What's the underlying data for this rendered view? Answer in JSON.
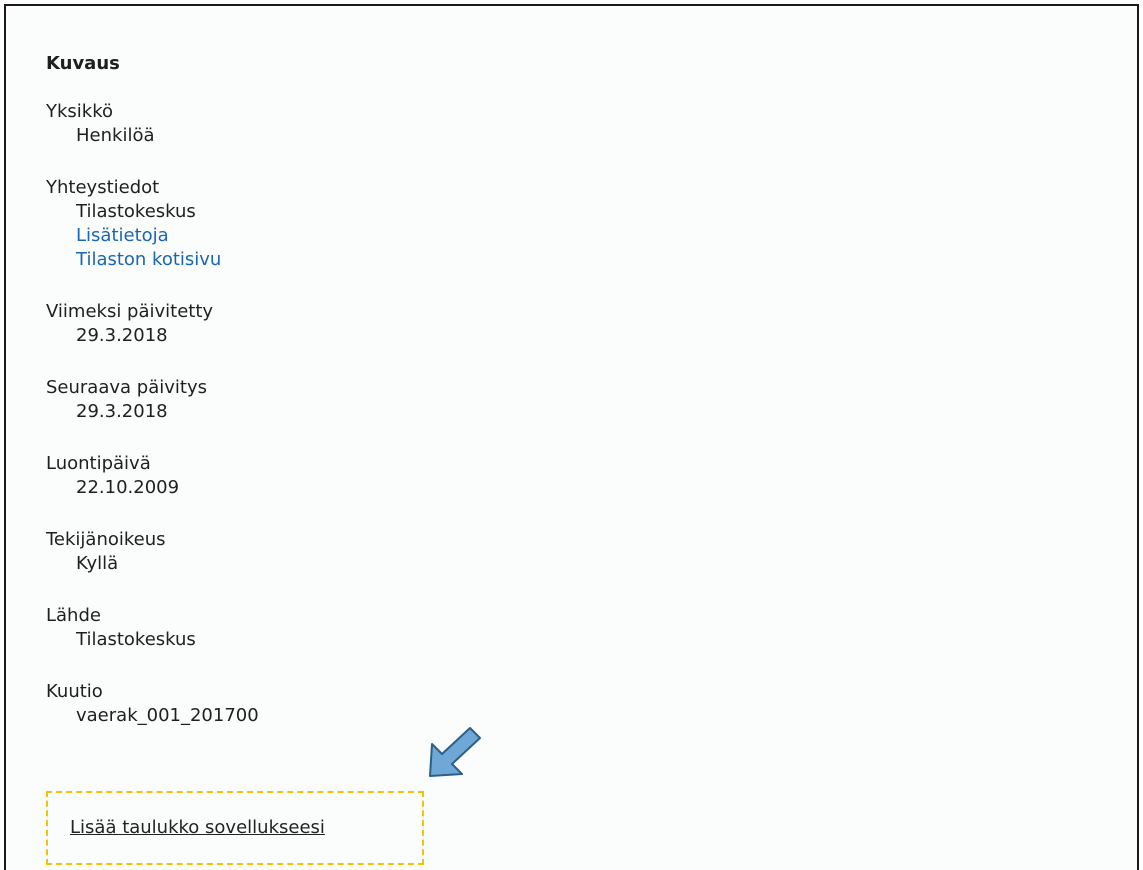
{
  "heading": "Kuvaus",
  "fields": {
    "unit": {
      "label": "Yksikkö",
      "value": "Henkilöä"
    },
    "contact": {
      "label": "Yhteystiedot",
      "value": "Tilastokeskus",
      "link_more": "Lisätietoja",
      "link_home": "Tilaston kotisivu"
    },
    "last_updated": {
      "label": "Viimeksi päivitetty",
      "value": "29.3.2018"
    },
    "next_update": {
      "label": "Seuraava päivitys",
      "value": "29.3.2018"
    },
    "created": {
      "label": "Luontipäivä",
      "value": "22.10.2009"
    },
    "copyright": {
      "label": "Tekijänoikeus",
      "value": "Kyllä"
    },
    "source": {
      "label": "Lähde",
      "value": "Tilastokeskus"
    },
    "cube": {
      "label": "Kuutio",
      "value": "vaerak_001_201700"
    }
  },
  "embed_link": "Lisää taulukko sovellukseesi",
  "colors": {
    "link": "#1a66b2",
    "highlight_border": "#f4c200",
    "arrow_fill": "#6fa8d6",
    "arrow_stroke": "#2c5f8a"
  },
  "icons": {
    "callout_arrow": "arrow-down-left-icon"
  }
}
